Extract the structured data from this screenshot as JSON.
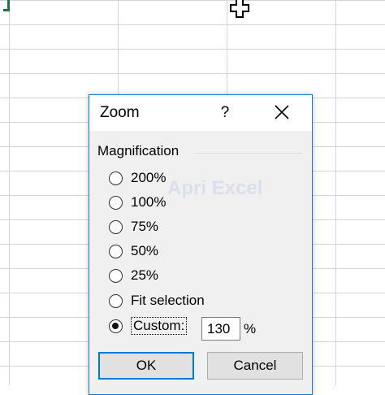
{
  "dialog": {
    "title": "Zoom",
    "help_label": "?",
    "group_label": "Magnification",
    "options": [
      {
        "label": "200%",
        "checked": false
      },
      {
        "label": "100%",
        "checked": false
      },
      {
        "label": "75%",
        "checked": false
      },
      {
        "label": "50%",
        "checked": false
      },
      {
        "label": "25%",
        "checked": false
      },
      {
        "label": "Fit selection",
        "checked": false
      },
      {
        "label": "Custom:",
        "checked": true
      }
    ],
    "custom_value": "130",
    "percent_sign": "%",
    "ok_label": "OK",
    "cancel_label": "Cancel"
  },
  "watermark": "Apri Excel",
  "colors": {
    "dialog_border": "#1979ca",
    "default_button_border": "#0078d7",
    "selection_green": "#217346"
  }
}
